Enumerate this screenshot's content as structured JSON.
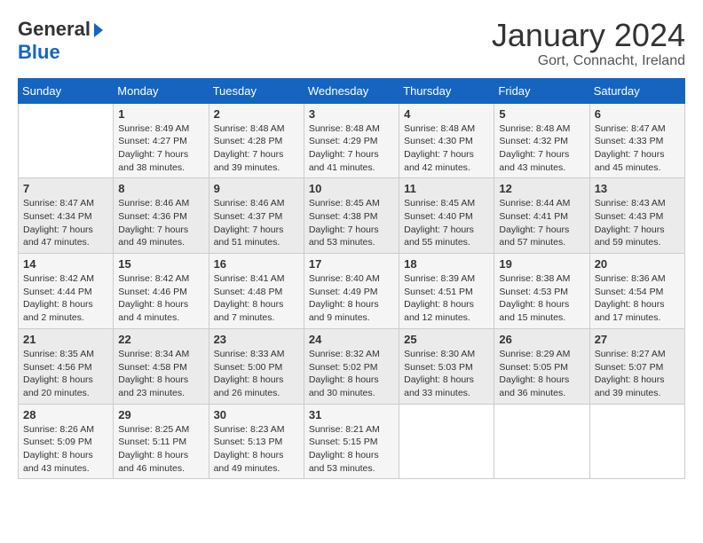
{
  "header": {
    "logo_general": "General",
    "logo_blue": "Blue",
    "month_title": "January 2024",
    "location": "Gort, Connacht, Ireland"
  },
  "weekdays": [
    "Sunday",
    "Monday",
    "Tuesday",
    "Wednesday",
    "Thursday",
    "Friday",
    "Saturday"
  ],
  "weeks": [
    [
      {
        "day": "",
        "info": ""
      },
      {
        "day": "1",
        "info": "Sunrise: 8:49 AM\nSunset: 4:27 PM\nDaylight: 7 hours\nand 38 minutes."
      },
      {
        "day": "2",
        "info": "Sunrise: 8:48 AM\nSunset: 4:28 PM\nDaylight: 7 hours\nand 39 minutes."
      },
      {
        "day": "3",
        "info": "Sunrise: 8:48 AM\nSunset: 4:29 PM\nDaylight: 7 hours\nand 41 minutes."
      },
      {
        "day": "4",
        "info": "Sunrise: 8:48 AM\nSunset: 4:30 PM\nDaylight: 7 hours\nand 42 minutes."
      },
      {
        "day": "5",
        "info": "Sunrise: 8:48 AM\nSunset: 4:32 PM\nDaylight: 7 hours\nand 43 minutes."
      },
      {
        "day": "6",
        "info": "Sunrise: 8:47 AM\nSunset: 4:33 PM\nDaylight: 7 hours\nand 45 minutes."
      }
    ],
    [
      {
        "day": "7",
        "info": "Sunrise: 8:47 AM\nSunset: 4:34 PM\nDaylight: 7 hours\nand 47 minutes."
      },
      {
        "day": "8",
        "info": "Sunrise: 8:46 AM\nSunset: 4:36 PM\nDaylight: 7 hours\nand 49 minutes."
      },
      {
        "day": "9",
        "info": "Sunrise: 8:46 AM\nSunset: 4:37 PM\nDaylight: 7 hours\nand 51 minutes."
      },
      {
        "day": "10",
        "info": "Sunrise: 8:45 AM\nSunset: 4:38 PM\nDaylight: 7 hours\nand 53 minutes."
      },
      {
        "day": "11",
        "info": "Sunrise: 8:45 AM\nSunset: 4:40 PM\nDaylight: 7 hours\nand 55 minutes."
      },
      {
        "day": "12",
        "info": "Sunrise: 8:44 AM\nSunset: 4:41 PM\nDaylight: 7 hours\nand 57 minutes."
      },
      {
        "day": "13",
        "info": "Sunrise: 8:43 AM\nSunset: 4:43 PM\nDaylight: 7 hours\nand 59 minutes."
      }
    ],
    [
      {
        "day": "14",
        "info": "Sunrise: 8:42 AM\nSunset: 4:44 PM\nDaylight: 8 hours\nand 2 minutes."
      },
      {
        "day": "15",
        "info": "Sunrise: 8:42 AM\nSunset: 4:46 PM\nDaylight: 8 hours\nand 4 minutes."
      },
      {
        "day": "16",
        "info": "Sunrise: 8:41 AM\nSunset: 4:48 PM\nDaylight: 8 hours\nand 7 minutes."
      },
      {
        "day": "17",
        "info": "Sunrise: 8:40 AM\nSunset: 4:49 PM\nDaylight: 8 hours\nand 9 minutes."
      },
      {
        "day": "18",
        "info": "Sunrise: 8:39 AM\nSunset: 4:51 PM\nDaylight: 8 hours\nand 12 minutes."
      },
      {
        "day": "19",
        "info": "Sunrise: 8:38 AM\nSunset: 4:53 PM\nDaylight: 8 hours\nand 15 minutes."
      },
      {
        "day": "20",
        "info": "Sunrise: 8:36 AM\nSunset: 4:54 PM\nDaylight: 8 hours\nand 17 minutes."
      }
    ],
    [
      {
        "day": "21",
        "info": "Sunrise: 8:35 AM\nSunset: 4:56 PM\nDaylight: 8 hours\nand 20 minutes."
      },
      {
        "day": "22",
        "info": "Sunrise: 8:34 AM\nSunset: 4:58 PM\nDaylight: 8 hours\nand 23 minutes."
      },
      {
        "day": "23",
        "info": "Sunrise: 8:33 AM\nSunset: 5:00 PM\nDaylight: 8 hours\nand 26 minutes."
      },
      {
        "day": "24",
        "info": "Sunrise: 8:32 AM\nSunset: 5:02 PM\nDaylight: 8 hours\nand 30 minutes."
      },
      {
        "day": "25",
        "info": "Sunrise: 8:30 AM\nSunset: 5:03 PM\nDaylight: 8 hours\nand 33 minutes."
      },
      {
        "day": "26",
        "info": "Sunrise: 8:29 AM\nSunset: 5:05 PM\nDaylight: 8 hours\nand 36 minutes."
      },
      {
        "day": "27",
        "info": "Sunrise: 8:27 AM\nSunset: 5:07 PM\nDaylight: 8 hours\nand 39 minutes."
      }
    ],
    [
      {
        "day": "28",
        "info": "Sunrise: 8:26 AM\nSunset: 5:09 PM\nDaylight: 8 hours\nand 43 minutes."
      },
      {
        "day": "29",
        "info": "Sunrise: 8:25 AM\nSunset: 5:11 PM\nDaylight: 8 hours\nand 46 minutes."
      },
      {
        "day": "30",
        "info": "Sunrise: 8:23 AM\nSunset: 5:13 PM\nDaylight: 8 hours\nand 49 minutes."
      },
      {
        "day": "31",
        "info": "Sunrise: 8:21 AM\nSunset: 5:15 PM\nDaylight: 8 hours\nand 53 minutes."
      },
      {
        "day": "",
        "info": ""
      },
      {
        "day": "",
        "info": ""
      },
      {
        "day": "",
        "info": ""
      }
    ]
  ]
}
